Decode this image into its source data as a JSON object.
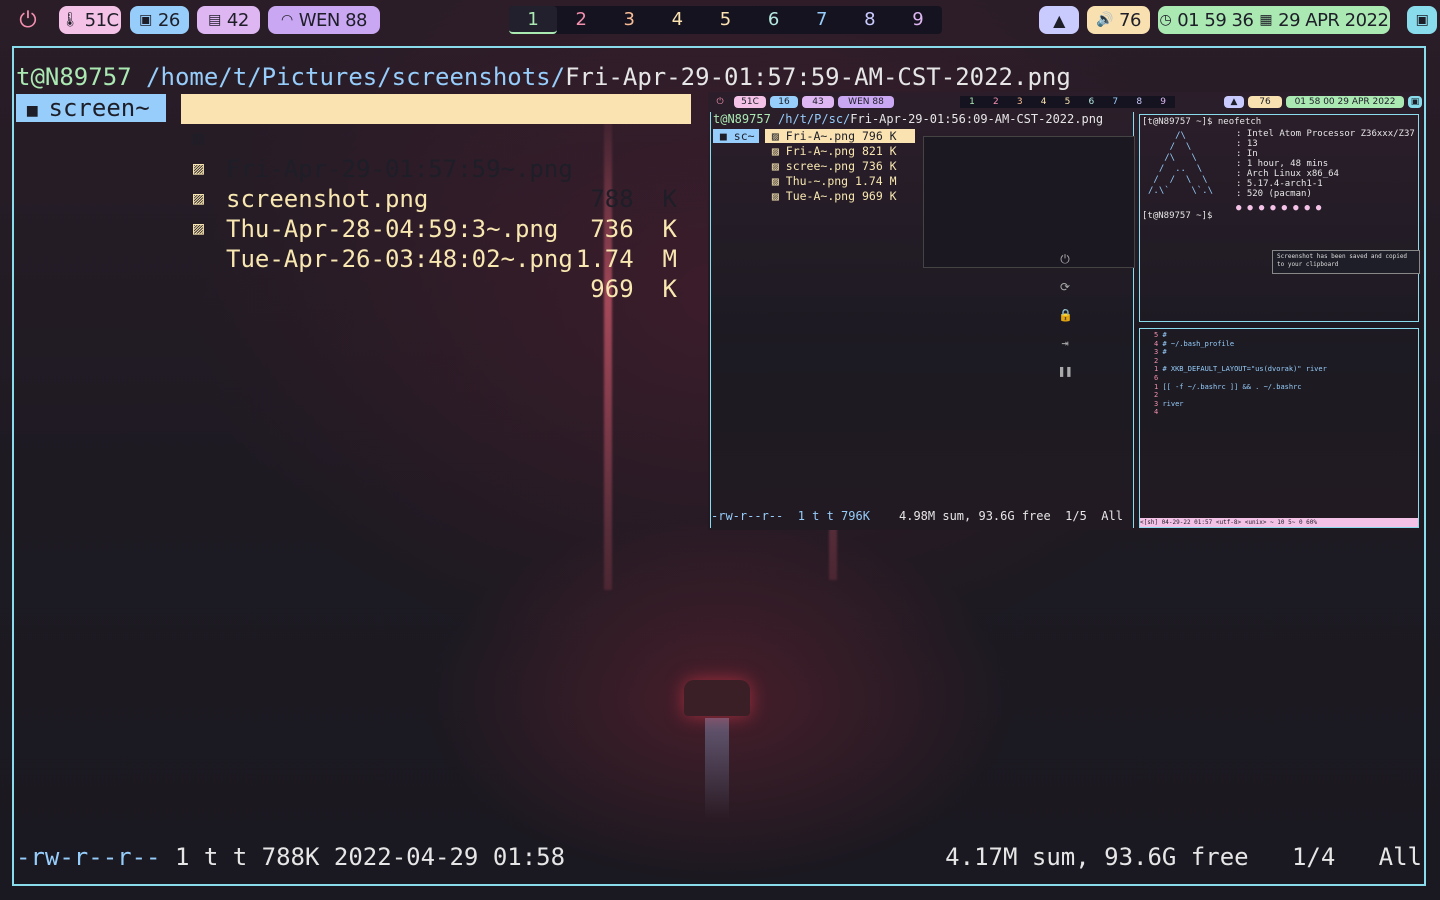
{
  "topbar": {
    "temp": "51C",
    "cpu": "26",
    "mem": "42",
    "wifi": "WEN 88",
    "workspaces": [
      "1",
      "2",
      "3",
      "4",
      "5",
      "6",
      "7",
      "8",
      "9"
    ],
    "volume": "76",
    "time": "01 59 36",
    "date": "29 APR 2022",
    "colors": {
      "temp": "#f5c2e7",
      "cpu": "#96cdfb",
      "mem": "#ddb6f2",
      "wifi": "#c9a7f2",
      "volume": "#f8e0b0",
      "clock": "#abe9b3",
      "picture": "#c9cbff"
    }
  },
  "terminal": {
    "prompt_user": "t@N89757",
    "prompt_path": "/home/t/Pictures/screenshots/",
    "prompt_file": "Fri-Apr-29-01:57:59-AM-CST-2022.png",
    "dir": "screen~",
    "files": [
      {
        "name": "Fri-Apr-29-01:57:59~.png",
        "size": "788  K"
      },
      {
        "name": "screenshot.png",
        "size": "736  K"
      },
      {
        "name": "Thu-Apr-28-04:59:3~.png",
        "size": "1.74  M"
      },
      {
        "name": "Tue-Apr-26-03:48:02~.png",
        "size": "969  K"
      }
    ],
    "status_perm": "-rw-r--r--",
    "status_info": " 1 t t 788K 2022-04-29 01:58",
    "status_sum": "4.17M sum, 93.6G free   1/4   All"
  },
  "preview": {
    "temp": "51C",
    "cpu": "16",
    "mem": "43",
    "wifi": "WEN 88",
    "volume": "76",
    "clock": "01 58 00",
    "date": "29 APR 2022",
    "prompt_user": "t@N89757",
    "prompt_path": "/h/t/P/sc/",
    "prompt_file": "Fri-Apr-29-01:56:09-AM-CST-2022.png",
    "dir": "sc~",
    "files": [
      {
        "name": "Fri-A~.png",
        "size": "796 K"
      },
      {
        "name": "Fri-A~.png",
        "size": "821 K"
      },
      {
        "name": "scree~.png",
        "size": "736 K"
      },
      {
        "name": "Thu-~.png",
        "size": "1.74 M"
      },
      {
        "name": "Tue-A~.png",
        "size": "969 K"
      }
    ],
    "status_left": "-rw-r--r--  1 t t 796K",
    "status_right": "4.98M sum, 93.6G free  1/5  All",
    "neofetch_cmd": "[t@N89757 ~]$ neofetch",
    "neofetch_lines": [
      ": Intel Atom Processor Z36xxx/Z37",
      ": 13",
      ": In",
      ": 1 hour, 48 mins",
      ": Arch Linux x86_64",
      ": 5.17.4-arch1-1",
      ": 520 (pacman)"
    ],
    "prompt2": "[t@N89757 ~]$ ",
    "notification": "Screenshot has been saved and copied to your clipboard",
    "bash_lines": [
      {
        "n": "5",
        "t": "#"
      },
      {
        "n": "4",
        "t": "# ~/.bash_profile"
      },
      {
        "n": "3",
        "t": "#"
      },
      {
        "n": "2",
        "t": ""
      },
      {
        "n": "1",
        "t": "# XKB_DEFAULT_LAYOUT=\"us(dvorak)\" river"
      },
      {
        "n": "6",
        "t": ""
      },
      {
        "n": "1",
        "t": "[[ -f ~/.bashrc ]] && . ~/.bashrc"
      },
      {
        "n": "2",
        "t": ""
      },
      {
        "n": "3",
        "t": "river"
      },
      {
        "n": "4",
        "t": ""
      }
    ],
    "editor_status": "<[sh] 04-29-22 01:57 <utf-8> <unix> ~ 10 5~ 0 60%"
  }
}
